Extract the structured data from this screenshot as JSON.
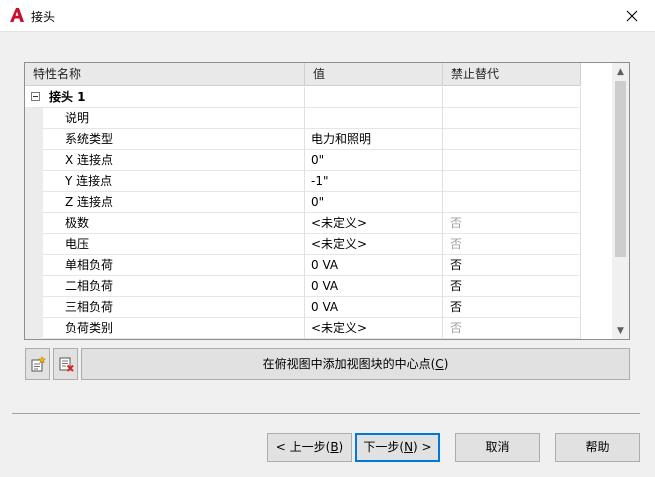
{
  "window": {
    "title": "接头",
    "app_icon": "autocad-a-icon",
    "close_icon": "close-icon",
    "accent_color": "#0078d7",
    "brand_color": "#c8102e"
  },
  "grid": {
    "headers": {
      "name": "特性名称",
      "value": "值",
      "override": "禁止替代"
    },
    "group": {
      "label": "接头 1",
      "expanded": true
    },
    "rows": [
      {
        "name": "说明",
        "value": "",
        "override": ""
      },
      {
        "name": "系统类型",
        "value": "电力和照明",
        "override": ""
      },
      {
        "name": "X 连接点",
        "value": "0\"",
        "override": ""
      },
      {
        "name": "Y 连接点",
        "value": "-1\"",
        "override": ""
      },
      {
        "name": "Z 连接点",
        "value": "0\"",
        "override": ""
      },
      {
        "name": "极数",
        "value": "<未定义>",
        "override": "否"
      },
      {
        "name": "电压",
        "value": "<未定义>",
        "override": "否"
      },
      {
        "name": "单相负荷",
        "value": "0 VA",
        "override": "否"
      },
      {
        "name": "二相负荷",
        "value": "0 VA",
        "override": "否"
      },
      {
        "name": "三相负荷",
        "value": "0 VA",
        "override": "否"
      },
      {
        "name": "负荷类别",
        "value": "<未定义>",
        "override": "否"
      }
    ]
  },
  "toolbar": {
    "add_label": "在俯视图中添加视图块的中心点(",
    "add_key": "C",
    "add_close": ")",
    "new_icon": "new-connector-icon",
    "delete_icon": "delete-connector-icon"
  },
  "footer": {
    "back_pre": "< 上一步(",
    "back_key": "B",
    "back_post": ")",
    "next_pre": "下一步(",
    "next_key": "N",
    "next_post": ") >",
    "cancel": "取消",
    "help": "帮助"
  }
}
